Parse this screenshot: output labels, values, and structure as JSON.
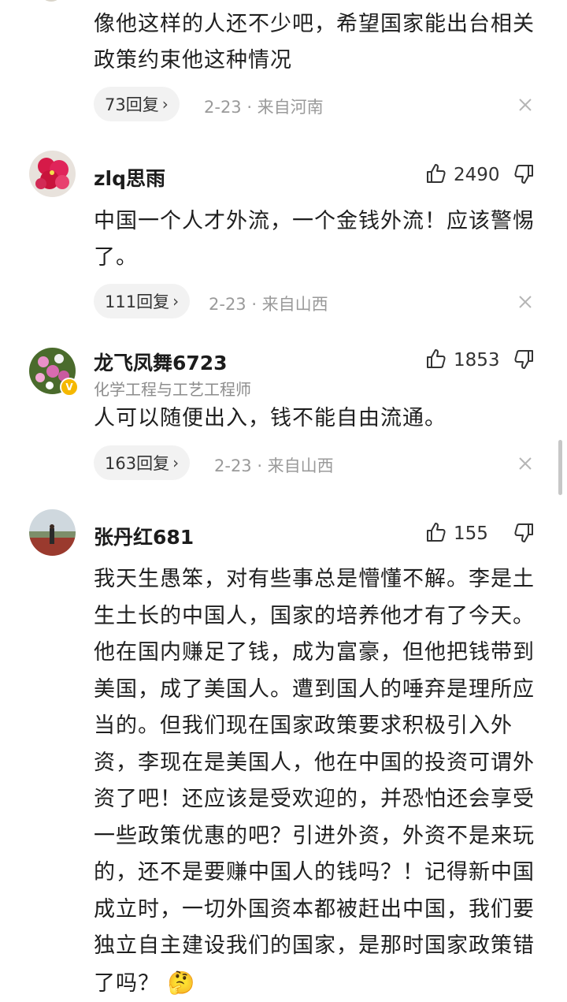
{
  "comments": [
    {
      "text": "像他这样的人还不少吧，希望国家能出台相关政策约束他这种情况",
      "reply_label": "73回复",
      "meta": "2-23 · 来自河南"
    },
    {
      "username": "zlq思雨",
      "likes": "2490",
      "text": "中国一个人才外流，一个金钱外流！应该警惕了。",
      "reply_label": "111回复",
      "meta": "2-23 · 来自山西"
    },
    {
      "username": "龙飞凤舞6723",
      "subtitle": "化学工程与工艺工程师",
      "likes": "1853",
      "text": "人可以随便出入，钱不能自由流通。",
      "reply_label": "163回复",
      "meta": "2-23 · 来自山西"
    },
    {
      "username": "张丹红681",
      "likes": "155",
      "text": "我天生愚笨，对有些事总是懵懂不解。李是土生土长的中国人，国家的培养他才有了今天。他在国内赚足了钱，成为富豪，但他把钱带到美国，成了美国人。遭到国人的唾弃是理所应当的。但我们现在国家政策要求积极引入外资，李现在是美国人，他在中国的投资可谓外资了吧！还应该是受欢迎的，并恐怕还会享受一些政策优惠的吧？引进外资，外资不是来玩的，还不是要赚中国人的钱吗？！记得新中国成立时，一切外国资本都被赶出中国，我们要独立自主建设我们的国家，是那时国家政策错了吗？",
      "emoji": "🤔"
    }
  ],
  "chevron": "›",
  "colors": {
    "chip_bg": "#f2f2f2",
    "meta_gray": "#9a9a9a",
    "badge_gold": "#f5b800"
  },
  "icons": [
    "thumbs-up-icon",
    "thumbs-down-icon",
    "close-icon",
    "chevron-right-icon",
    "verified-badge-icon"
  ]
}
